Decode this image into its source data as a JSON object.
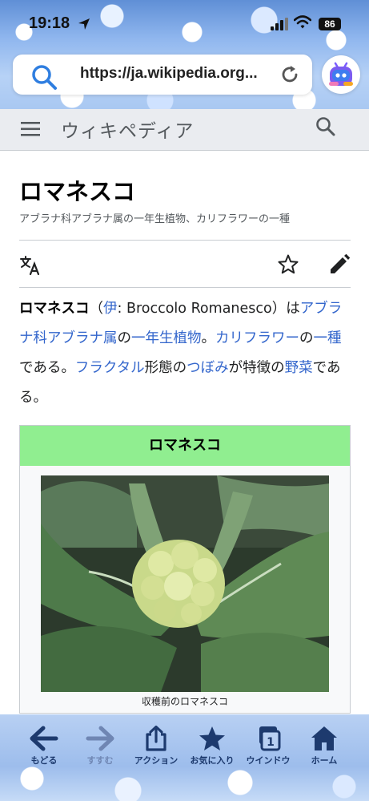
{
  "status_bar": {
    "time": "19:18",
    "battery": "86"
  },
  "browser": {
    "url": "https://ja.wikipedia.org..."
  },
  "wiki_header": {
    "logo": "ウィキペディア"
  },
  "article": {
    "title": "ロマネスコ",
    "subtitle": "アブラナ科アブラナ属の一年生植物、カリフラワーの一種",
    "lead": {
      "term": "ロマネスコ",
      "p1": "（",
      "l_it": "伊",
      "p2": ": Broccolo Romanesco）は",
      "l_family": "アブラナ科アブラナ属",
      "p3": "の",
      "l_annual": "一年生植物",
      "p4": "。",
      "l_cauliflower": "カリフラワー",
      "p5": "の",
      "l_kind": "一種",
      "p6": "である。",
      "l_fractal": "フラクタル",
      "p7": "形態の",
      "l_bud": "つぼみ",
      "p8": "が特徴の",
      "l_vegetable": "野菜",
      "p9": "である。"
    }
  },
  "infobox": {
    "title": "ロマネスコ",
    "caption": "収穫前のロマネスコ"
  },
  "toolbar": {
    "back": "もどる",
    "forward": "すすむ",
    "action": "アクション",
    "favorites": "お気に入り",
    "windows": "ウインドウ",
    "windows_count": "1",
    "home": "ホーム"
  },
  "colors": {
    "link": "#3366cc",
    "infobox_header": "#90ee90",
    "toolbar_icon": "#1d3a6e"
  }
}
